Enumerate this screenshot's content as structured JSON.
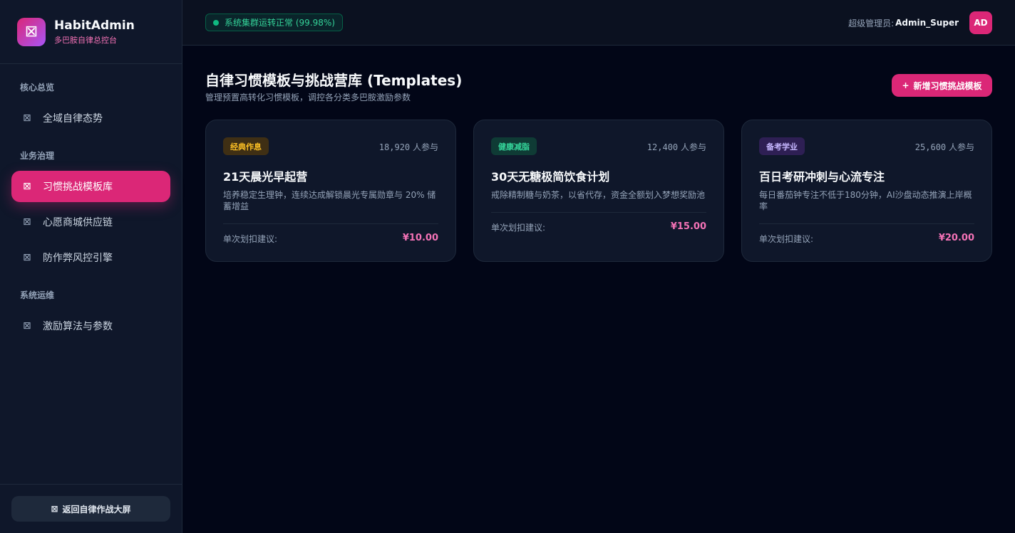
{
  "brand": {
    "name": "HabitAdmin",
    "subtitle": "多巴胺自律总控台",
    "logo_icon": "box-icon"
  },
  "sidebar": {
    "sections": [
      {
        "label": "核心总览"
      },
      {
        "label": "业务治理"
      },
      {
        "label": "系统运维"
      }
    ],
    "items": [
      {
        "label": "全域自律态势",
        "icon": "⊠",
        "active": false
      },
      {
        "label": "习惯挑战模板库",
        "icon": "⊠",
        "active": true
      },
      {
        "label": "心愿商城供应链",
        "icon": "⊠",
        "active": false
      },
      {
        "label": "防作弊风控引擎",
        "icon": "⊠",
        "active": false
      },
      {
        "label": "激励算法与参数",
        "icon": "⊠",
        "active": false
      }
    ],
    "footer_button": "返回自律作战大屏",
    "footer_icon": "⊠"
  },
  "topbar": {
    "status": "系统集群运转正常 (99.98%)",
    "admin_role": "超级管理员:",
    "admin_name": "Admin_Super",
    "avatar_initials": "AD"
  },
  "main": {
    "title": "自律习惯模板与挑战营库 (Templates)",
    "subtitle": "管理预置高转化习惯模板，调控各分类多巴胺激励参数",
    "add_button": "新增习惯挑战模板",
    "add_button_plus": "+"
  },
  "cards": [
    {
      "tag": "经典作息",
      "tag_bg": "#3f2f14",
      "tag_color": "#fbbf24",
      "participants_num": "18,920",
      "participants_suffix": "人参与",
      "title": "21天晨光早起营",
      "desc": "培养稳定生理钟，连续达成解锁晨光专属勋章与 20% 储蓄增益",
      "price_label": "单次划扣建议:",
      "price": "¥10.00"
    },
    {
      "tag": "健康减脂",
      "tag_bg": "#0f3b35",
      "tag_color": "#34d399",
      "participants_num": "12,400",
      "participants_suffix": "人参与",
      "title": "30天无糖极简饮食计划",
      "desc": "戒除精制糖与奶茶，以省代存，资金全额划入梦想奖励池",
      "price_label": "单次划扣建议:",
      "price": "¥15.00"
    },
    {
      "tag": "备考学业",
      "tag_bg": "#2e1f54",
      "tag_color": "#c4b5fd",
      "participants_num": "25,600",
      "participants_suffix": "人参与",
      "title": "百日考研冲刺与心流专注",
      "desc": "每日番茄钟专注不低于180分钟，AI沙盘动态推演上岸概率",
      "price_label": "单次划扣建议:",
      "price": "¥20.00"
    }
  ]
}
